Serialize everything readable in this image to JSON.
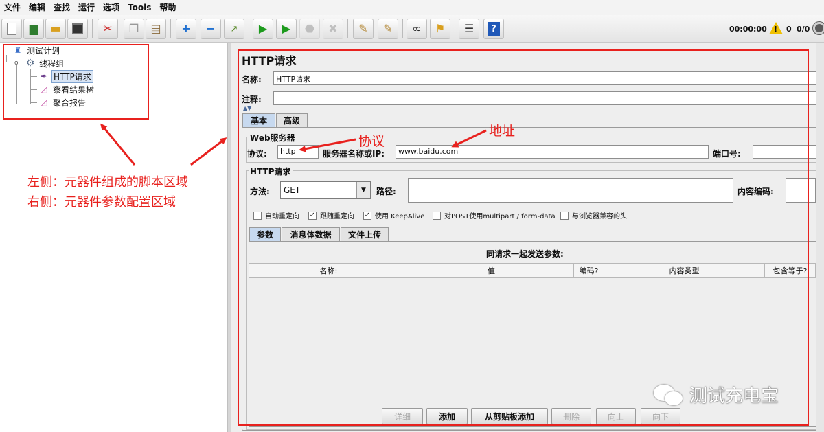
{
  "menu": [
    "文件",
    "编辑",
    "查找",
    "运行",
    "选项",
    "Tools",
    "帮助"
  ],
  "toolbar": {
    "icons": [
      "new-icon",
      "templates-icon",
      "open-icon",
      "save-icon",
      "cut-icon",
      "copy-icon",
      "paste-icon",
      "expand-icon",
      "collapse-icon",
      "toggle-icon",
      "start-icon",
      "start-no-pause-icon",
      "stop-icon",
      "shutdown-icon",
      "clear-icon",
      "clear-all-icon",
      "search-icon",
      "reset-search-icon",
      "function-helper-icon",
      "help-icon"
    ],
    "timer": "00:00:00",
    "warning_count": "0",
    "threads": "0/0"
  },
  "tree": {
    "plan": "测试计划",
    "thread_group": "线程组",
    "http_request": "HTTP请求",
    "result_tree": "察看结果树",
    "aggregate_report": "聚合报告"
  },
  "panel": {
    "title": "HTTP请求",
    "name_label": "名称:",
    "name_value": "HTTP请求",
    "comment_label": "注释:",
    "comment_value": "",
    "tabs": [
      "基本",
      "高级"
    ],
    "web_server": {
      "title": "Web服务器",
      "protocol_label": "协议:",
      "protocol_value": "http",
      "server_label": "服务器名称或IP:",
      "server_value": "www.baidu.com",
      "port_label": "端口号:",
      "port_value": ""
    },
    "http_request": {
      "title": "HTTP请求",
      "method_label": "方法:",
      "method_value": "GET",
      "path_label": "路径:",
      "path_value": "",
      "encoding_label": "内容编码:",
      "encoding_value": ""
    },
    "checkboxes": [
      {
        "label": "自动重定向",
        "checked": false
      },
      {
        "label": "跟随重定向",
        "checked": true
      },
      {
        "label": "使用 KeepAlive",
        "checked": true
      },
      {
        "label": "对POST使用multipart / form-data",
        "checked": false
      },
      {
        "label": "与浏览器兼容的头",
        "checked": false
      }
    ],
    "sub_tabs": [
      "参数",
      "消息体数据",
      "文件上传"
    ],
    "params_title": "同请求一起发送参数:",
    "columns": [
      "名称:",
      "值",
      "编码?",
      "内容类型",
      "包含等于?"
    ],
    "buttons": {
      "detail": "详细",
      "add": "添加",
      "add_clipboard": "从剪贴板添加",
      "delete": "删除",
      "up": "向上",
      "down": "向下"
    }
  },
  "annotations": {
    "left_note": "左侧：元器件组成的脚本区域",
    "right_note": "右侧：元器件参数配置区域",
    "protocol_callout": "协议",
    "address_callout": "地址",
    "accent_color": "#e8211e"
  },
  "watermark": "测试充电宝"
}
